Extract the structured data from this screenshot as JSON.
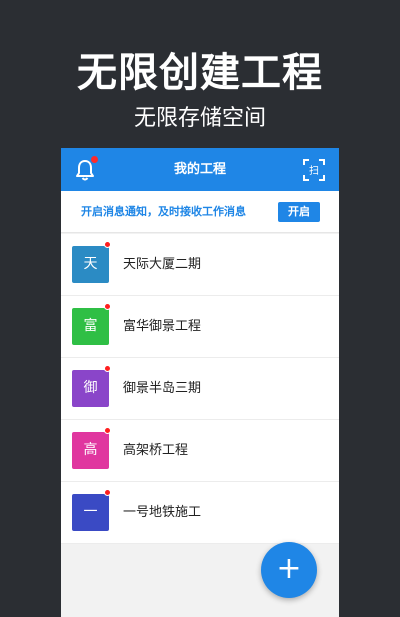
{
  "promo": {
    "title": "无限创建工程",
    "subtitle": "无限存储空间"
  },
  "appbar": {
    "title": "我的工程",
    "left_icon": "bell-icon",
    "right_icon": "scan-icon",
    "right_icon_text": "扫"
  },
  "notice": {
    "text": "开启消息通知，及时接收工作消息",
    "button_label": "开启"
  },
  "projects": [
    {
      "avatar": "天",
      "name": "天际大厦二期",
      "color": "#2b8bc4"
    },
    {
      "avatar": "富",
      "name": "富华御景工程",
      "color": "#2fbf45"
    },
    {
      "avatar": "御",
      "name": "御景半岛三期",
      "color": "#8a45c9"
    },
    {
      "avatar": "高",
      "name": "高架桥工程",
      "color": "#e0369f"
    },
    {
      "avatar": "一",
      "name": "一号地铁施工",
      "color": "#3a4ac4"
    }
  ],
  "fab": {
    "label": "+",
    "icon": "plus-icon"
  },
  "colors": {
    "primary": "#1f86e6",
    "background": "#2b2e33",
    "badge": "#ff2a2a"
  }
}
